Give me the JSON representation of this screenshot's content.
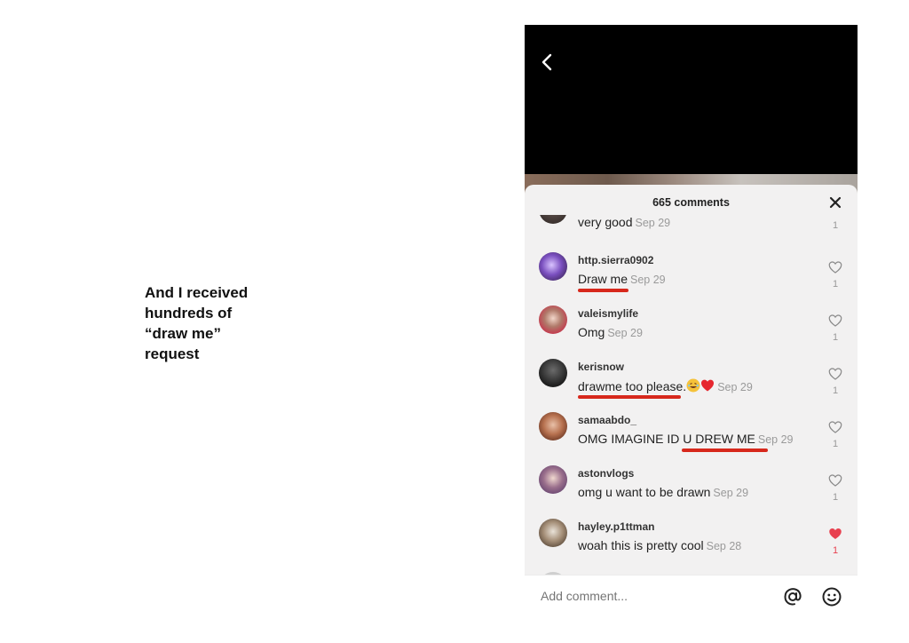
{
  "caption": {
    "line1": "And I received",
    "line2": "hundreds of",
    "line3": "“draw me”",
    "line4": "request"
  },
  "sheet": {
    "title": "665 comments"
  },
  "comments": [
    {
      "user": "",
      "text": "very good",
      "date": "Sep 29",
      "likes": "1",
      "liked": false
    },
    {
      "user": "http.sierra0902",
      "text": "Draw me",
      "date": "Sep 29",
      "likes": "1",
      "liked": false
    },
    {
      "user": "valeismylife",
      "text": "Omg",
      "date": "Sep 29",
      "likes": "1",
      "liked": false
    },
    {
      "user": "kerisnow",
      "text": "drawme too please.",
      "date": "Sep 29",
      "likes": "1",
      "liked": false
    },
    {
      "user": "samaabdo_",
      "text": "OMG IMAGINE ID U DREW ME",
      "date": "Sep 29",
      "likes": "1",
      "liked": false
    },
    {
      "user": "astonvlogs",
      "text": "omg u want to be drawn",
      "date": "Sep 29",
      "likes": "1",
      "liked": false
    },
    {
      "user": "hayley.p1ttman",
      "text": "woah this is pretty cool",
      "date": "Sep 28",
      "likes": "1",
      "liked": true
    }
  ],
  "footer": {
    "placeholder": "Add comment..."
  },
  "icons": {
    "back": "chevron-left-icon",
    "close": "close-icon",
    "like": "heart-icon",
    "mention": "at-icon",
    "emoji": "smiley-icon"
  },
  "colors": {
    "underline": "#d7281c",
    "liked": "#e8404f"
  }
}
